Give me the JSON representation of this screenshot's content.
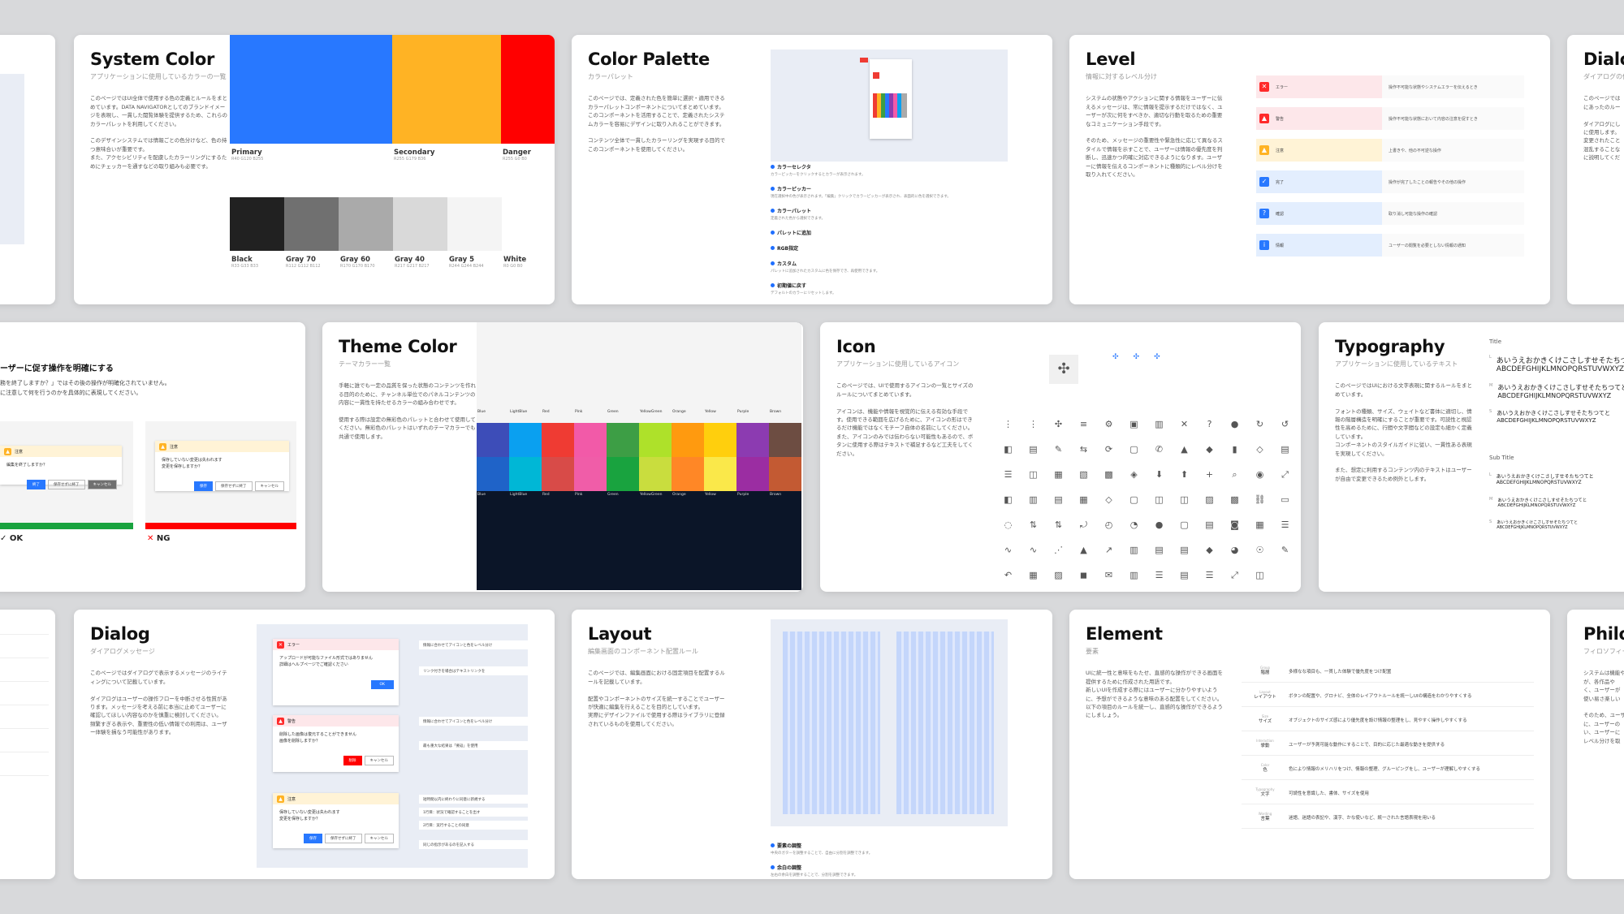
{
  "system_color": {
    "title": "System Color",
    "subtitle": "アプリケーションに使用しているカラーの一覧",
    "desc": "このページではUI全体で使用する色の定義とルールをまとめています。DATA NAVIGATORとしてのブランドイメージを表現し、一貫した閲覧体験を提供するため、これらのカラーパレットを利用してください。\n\nこのデザインシステムでは情報ごとの色分けなど、色の持つ意味合いが重要です。\nまた、アクセシビリティを配慮したカラーリングにするためにチェッカーを通すなどの取り組みも必要です。",
    "main": [
      {
        "name": "Primary",
        "rgb": "R40 G120 B255",
        "hex": "#2878ff"
      },
      {
        "name": "Secondary",
        "rgb": "R255 G179 B36",
        "hex": "#ffb324"
      },
      {
        "name": "Danger",
        "rgb": "R255 G0 B0",
        "hex": "#ff0000"
      }
    ],
    "grays": [
      {
        "name": "Black",
        "rgb": "R33 G33 B33",
        "hex": "#212121"
      },
      {
        "name": "Gray 70",
        "rgb": "R112 G112 B112",
        "hex": "#707070"
      },
      {
        "name": "Gray 60",
        "rgb": "R170 G170 B170",
        "hex": "#aaaaaa"
      },
      {
        "name": "Gray 40",
        "rgb": "R217 G217 B217",
        "hex": "#d9d9d9"
      },
      {
        "name": "Gray 5",
        "rgb": "R244 G244 B244",
        "hex": "#f4f4f4"
      },
      {
        "name": "White",
        "rgb": "R0 G0 B0",
        "hex": "#ffffff"
      }
    ]
  },
  "color_palette": {
    "title": "Color Palette",
    "subtitle": "カラーパレット",
    "desc": "このページでは、定義された色を簡単に選択・適用できるカラーパレットコンポーネントについてまとめています。このコンポーネントを活用することで、定義されたシステムカラーを容易にデザインに取り入れることができます。\n\nコンテンツ全体で一貫したカラーリングを実現する目的でこのコンポーネントを使用してください。",
    "items": [
      {
        "t": "カラーセレクタ",
        "d": "カラーピッカーをクリックするとカラーが表示されます。"
      },
      {
        "t": "カラーピッカー",
        "d": "現在選択中の色が表示されます。「編集」クリックでカラーピッカーが表示され、表面的に色を選択できます。"
      },
      {
        "t": "カラーパレット",
        "d": "定義された色から選択できます。"
      },
      {
        "t": "パレットに追加",
        "d": ""
      },
      {
        "t": "RGB指定",
        "d": ""
      },
      {
        "t": "カスタム",
        "d": "パレットに追加されたカスタムに色を保存でき、再使用できます。"
      },
      {
        "t": "初期値に戻す",
        "d": "デフォルトのカラーにリセットします。"
      }
    ]
  },
  "level": {
    "title": "Level",
    "subtitle": "情報に対するレベル分け",
    "desc": "システムの状態やアクションに関する情報をユーザーに伝えるメッセージは、常に情報を提示するだけではなく、ユーザーが次に何をすべきか、適切な行動を取るための重要なコミュニケーション手段です。\n\nそのため、メッセージの重要性や緊急性に応じて異なるスタイルで情報を示すことで、ユーザーは情報の優先度を判断し、迅速かつ的確に対応できるようになります。ユーザーに情報を伝えるコンポーネントに種類的にレベル分けを取り入れてください。",
    "rows": [
      {
        "label": "エラー",
        "desc": "操作不可能な状態やシステムエラーを伝えるとき",
        "color": "#ff2a2a",
        "bg": "#fde7ea",
        "glyph": "✕"
      },
      {
        "label": "警告",
        "desc": "操作不可能な状態において内容の注意を促すとき",
        "color": "#ff2a2a",
        "bg": "#fde7ea",
        "glyph": "▲"
      },
      {
        "label": "注意",
        "desc": "上書きや、他の不可逆な操作",
        "color": "#ffb324",
        "bg": "#fff3d6",
        "glyph": "▲"
      },
      {
        "label": "完了",
        "desc": "操作が完了したことの報告やその他の操作",
        "color": "#2878ff",
        "bg": "#e3eefe",
        "glyph": "✓"
      },
      {
        "label": "確認",
        "desc": "取り消し可能な操作の確認",
        "color": "#2878ff",
        "bg": "#e3eefe",
        "glyph": "?"
      },
      {
        "label": "情報",
        "desc": "ユーザーの閲覧を必要としない情報の通知",
        "color": "#2878ff",
        "bg": "#e3eefe",
        "glyph": "i"
      }
    ]
  },
  "dialog_left": {
    "title": "Dialo",
    "subtitle": "ダイアログの使",
    "desc": "このページでは\nにあったのルー\n\nダイアログにし\nに使用します。\n変更されたこと\n混乱することな\nに説明してくだ"
  },
  "ux": {
    "heading": "ーザーに促す操作を明確にする",
    "desc": "務を終了しますか？」ではその後の操作が明確化されていません。\nに注意して何を行うのかを具体的に表現してください。",
    "ok": "OK",
    "ng": "NG",
    "dlg_label": "注意",
    "dlg_text_ok": "編集を終了しますか？",
    "dlg_text_ng": "保存していない変更は失われます\n変更を保存しますか？",
    "btn_end": "終了",
    "btn_cancel": "キャンセル",
    "btn_save": "保存",
    "btn_nosave": "保存せずに終了"
  },
  "theme_color": {
    "title": "Theme Color",
    "subtitle": "テーマカラー一覧",
    "desc": "手軽に誰でも一定の品質を保った状態のコンテンツを作れる目的のために、チャンネル単位でのパネルコンテンツの内容に一貫性を持たせるカラーの組み合わせです。\n\n使用する際は設定の無彩色のパレットと合わせて使用してください。無彩色のパレットはいずれのテーマカラーでも共通で使用します。",
    "cols": [
      {
        "name": "Blue",
        "c1": "#3d4db8",
        "c2": "#1f63c8"
      },
      {
        "name": "LightBlue",
        "c1": "#0aa0f0",
        "c2": "#00b7d6"
      },
      {
        "name": "Red",
        "c1": "#ef3b33",
        "c2": "#d84b48"
      },
      {
        "name": "Pink",
        "c1": "#f25aa8",
        "c2": "#f05da8"
      },
      {
        "name": "Green",
        "c1": "#3d9e45",
        "c2": "#19a33f"
      },
      {
        "name": "YellowGreen",
        "c1": "#aee12a",
        "c2": "#c9dd3e"
      },
      {
        "name": "Orange",
        "c1": "#ff9a0f",
        "c2": "#ff8726"
      },
      {
        "name": "Yellow",
        "c1": "#ffcf0d",
        "c2": "#fae84a"
      },
      {
        "name": "Purple",
        "c1": "#8c3bb1",
        "c2": "#9b2da2"
      },
      {
        "name": "Brown",
        "c1": "#6d4d42",
        "c2": "#c35a33"
      }
    ]
  },
  "icon": {
    "title": "Icon",
    "subtitle": "アプリケーションに使用しているアイコン",
    "desc": "このページでは、UIで使用するアイコンの一覧とサイズのルールについてまとめています。\n\nアイコンは、機能や情報を視覚的に伝える有効な手段です。使用できる範囲を広げるために、アイコンの形はできるだけ機能ではなくモチーフ自体の名前にしてください。\nまた、アイコンのみでは伝わらない可能性もあるので、ボタンに使用する際はテキストで補足するなど工夫をしてください。",
    "glyphs": "⋮⋮✣≡⚙▣▥✕?●↻↺◧▤✎⇆⟳▢✆▲◆▮◇▤☰◫▦▧▩◈⬇⬆+⌕◉⤢◧▥▤▦◇▢◫◫▨▩⛓▭◌⇅⇅⤾◴◔●▢▤◙▦☰∿∿⋰▲↗▥▤▤◆◕☉✎↶▦▨◼✉▥☰▤☰⤢◫"
  },
  "typography": {
    "title": "Typography",
    "subtitle": "アプリケーションに使用しているテキスト",
    "desc": "このページではUIにおける文字表現に関するルールをまとめています。\n\nフォントの種類、サイズ、ウェイトなど書体に適切し、情報の階層構造を明確にすることが重要です。可読性と視認性を高めるために、行間や文字間などの設定も細かく定義しています。\nコンポーネントのスタイルガイドに従い、一貫性ある表現を実現してください。\n\nまた、想定に利用するコンテンツ内のテキストはユーザーが自由で変更できるため例外とします。",
    "title_label": "Title",
    "subtitle_label": "Sub Title",
    "jp": "あいうえおかきくけこさしすせそたちつてと",
    "en": "ABCDEFGHIJKLMNOPQRSTUVWXYZ",
    "sizes": [
      "L",
      "M",
      "S"
    ]
  },
  "dialog": {
    "title": "Dialog",
    "subtitle": "ダイアログメッセージ",
    "desc": "このページではダイアログで表示するメッセージのライティングについて記載しています。\n\nダイアログはユーザーの操作フローを中断させる性質があります。メッセージを考える前に本当に止めてユーザーに確認してほしい内容なのかを慎重に検討してください。\n頻繁すぎる表示や、重要性の低い情報での利用は、ユーザー体験を損なう可能性があります。",
    "e1": "エラー",
    "e1t": "アップロードが可能なファイル形式ではありません\n詳細はヘルプページでご確認ください",
    "ok": "OK",
    "e2": "警告",
    "e2t": "削除した画像は復元することができません\n画像を削除しますか？",
    "del": "削除",
    "cancel": "キャンセル",
    "e3": "注意",
    "e3t": "保存していない変更は失われます\n変更を保存しますか？",
    "save": "保存",
    "nosave": "保存せずに終了",
    "notes": [
      "情報に合わせてアイコンと色をレベル分け",
      "リンク付きを場合はテキストリンクを",
      "情報に合わせてアイコンと色をレベル分け",
      "最も重大な結果は「要返」を使用",
      "短時間以内に終わりに同意に新規する",
      "1行目：状況で確認することを出す",
      "2行目：実行することの同意",
      "同じの指示があるのを記入する"
    ]
  },
  "layout": {
    "title": "Layout",
    "subtitle": "編集画面のコンポーネント配置ルール",
    "desc": "このページでは、編集画面における固定項目を配置するルールを記載しています。\n\n配置やコンポーネントのサイズを統一することでユーザーが快適に編集を行えることを目的としています。\n実際にデザインファイルで使用する際はライブラリに登録されているものを使用してください。",
    "n1": "要素の調整",
    "d1": "中央のガターを調整することで、自由に分割を調整できます。",
    "n2": "余白の調整",
    "d2": "左右の余白を調整することで、分割を調整できます。"
  },
  "element": {
    "title": "Element",
    "subtitle": "要素",
    "desc": "UIに統一性と意味をもたせ、直感的な操作ができる画面を提供するために作成された用語です。\n新しいUIを作成する際にはユーザーに分かりやすいように、予想ができるような意味のある配置をしてください。\n以下の項目のルールを統一し、直感的な操作ができるようにしましょう。",
    "rows": [
      {
        "en": "Group",
        "jp": "階層",
        "d": "多様なな項目も、一貫した体験で優先度をつけ配置"
      },
      {
        "en": "Layout",
        "jp": "レイアウト",
        "d": "ボタンの配置や、グロナビ、全体のレイアウトルールを統一しUIの構造をわかりやすくする"
      },
      {
        "en": "Size",
        "jp": "サイズ",
        "d": "オブジェクトのサイズ感により優先度を設け情報の整理をし、見やすく操作しやすくする"
      },
      {
        "en": "Interaction",
        "jp": "挙動",
        "d": "ユーザーが予測可能な動作にすることで、目的に応じた最適な動きを提供する"
      },
      {
        "en": "Color",
        "jp": "色",
        "d": "色により情報のメリハリをつけ、情報の整理、グルーピングをし、ユーザーが理解しやすくする"
      },
      {
        "en": "Typography",
        "jp": "文字",
        "d": "可読性を意識した、書体、サイズを使用"
      },
      {
        "en": "Wording",
        "jp": "言葉",
        "d": "迷語、迷語の表記や、漢字、かな使いなど、統一された言語表現を用いる"
      }
    ]
  },
  "philo": {
    "title": "Philo",
    "subtitle": "フィロソフィー",
    "desc": "システムは機能や\nが、各作品や\nく、ユーザーが\n使い易さ楽しい\n\nそのため、ユーザ\nに、ユーザーの\nい、ユーザーに\nレベル分けを取"
  }
}
